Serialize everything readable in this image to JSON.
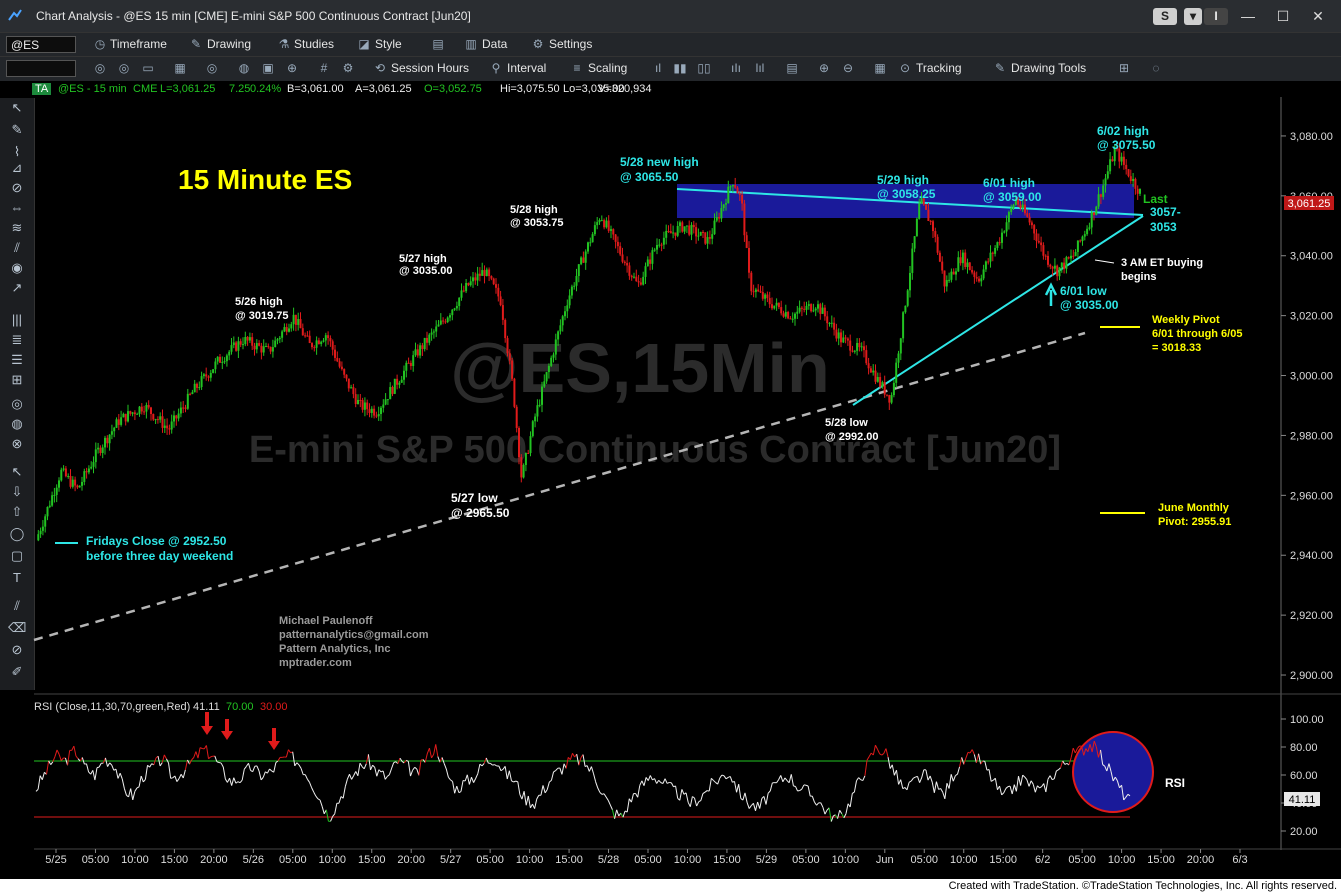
{
  "window": {
    "title": "Chart Analysis - @ES 15 min [CME] E-mini S&P 500 Continuous Contract [Jun20]",
    "badge_s": "S",
    "badge_i": "I",
    "minimize": "—",
    "maximize": "☐",
    "close": "✕"
  },
  "toolbar1": {
    "symbol": "@ES",
    "timeframe": "Timeframe",
    "drawing": "Drawing",
    "studies": "Studies",
    "style": "Style",
    "data": "Data",
    "settings": "Settings"
  },
  "toolbar2": {
    "session_hours": "Session Hours",
    "interval": "Interval",
    "scaling": "Scaling",
    "tracking": "Tracking",
    "drawing_tools": "Drawing Tools"
  },
  "status": {
    "tag": "TA",
    "symbol": "@ES - 15 min",
    "exchange": "CME",
    "last": "L=3,061.25",
    "change": "7.25",
    "change_pct": "0.24%",
    "bid": "B=3,061.00",
    "ask": "A=3,061.25",
    "open": "O=3,052.75",
    "high": "Hi=3,075.50",
    "low": "Lo=3,035.00",
    "volume": "V=320,934"
  },
  "chart_data": {
    "type": "candlestick",
    "title": "15 Minute ES",
    "watermark_symbol": "@ES,15Min",
    "watermark_name": "E-mini S&P 500 Continuous Contract [Jun20]",
    "y_ticks": [
      "3,080.00",
      "3,060.00",
      "3,040.00",
      "3,020.00",
      "3,000.00",
      "2,980.00",
      "2,960.00",
      "2,940.00",
      "2,920.00",
      "2,900.00"
    ],
    "ylim": [
      2895,
      3092
    ],
    "last_price_label": "3,061.25",
    "x_ticks": [
      "5/25",
      "05:00",
      "10:00",
      "15:00",
      "20:00",
      "5/26",
      "05:00",
      "10:00",
      "15:00",
      "20:00",
      "5/27",
      "05:00",
      "10:00",
      "15:00",
      "5/28",
      "05:00",
      "10:00",
      "15:00",
      "5/29",
      "05:00",
      "10:00",
      "Jun",
      "05:00",
      "10:00",
      "15:00",
      "6/2",
      "05:00",
      "10:00",
      "15:00",
      "20:00",
      "6/3"
    ],
    "price_path": [
      [
        0,
        2945
      ],
      [
        0.2,
        2952.5
      ],
      [
        0.6,
        2968
      ],
      [
        1,
        2962
      ],
      [
        1.5,
        2975
      ],
      [
        2,
        2985
      ],
      [
        2.6,
        2990
      ],
      [
        3.2,
        2982
      ],
      [
        3.8,
        2995
      ],
      [
        4.4,
        3005
      ],
      [
        5,
        3012
      ],
      [
        5.6,
        3008
      ],
      [
        6.2,
        3019.75
      ],
      [
        6.6,
        3010
      ],
      [
        7,
        3014
      ],
      [
        7.4,
        3000
      ],
      [
        7.8,
        2990
      ],
      [
        8.2,
        2988
      ],
      [
        8.6,
        2996
      ],
      [
        9.2,
        3008
      ],
      [
        9.8,
        3018
      ],
      [
        10.4,
        3030
      ],
      [
        10.8,
        3035
      ],
      [
        11.2,
        3025
      ],
      [
        11.5,
        2995
      ],
      [
        11.7,
        2965.5
      ],
      [
        12,
        2985
      ],
      [
        12.4,
        3005
      ],
      [
        12.8,
        3025
      ],
      [
        13.2,
        3040
      ],
      [
        13.6,
        3053.75
      ],
      [
        14,
        3043
      ],
      [
        14.5,
        3030
      ],
      [
        15,
        3045
      ],
      [
        15.6,
        3050
      ],
      [
        16.2,
        3045
      ],
      [
        16.8,
        3065.5
      ],
      [
        17,
        3058
      ],
      [
        17.2,
        3030
      ],
      [
        17.6,
        3025
      ],
      [
        18.2,
        3020
      ],
      [
        18.8,
        3024
      ],
      [
        19.4,
        3012
      ],
      [
        19.9,
        3008
      ],
      [
        20.3,
        2998
      ],
      [
        20.6,
        2992
      ],
      [
        20.9,
        3020
      ],
      [
        21.3,
        3058.25
      ],
      [
        21.6,
        3050
      ],
      [
        21.9,
        3030
      ],
      [
        22.3,
        3040
      ],
      [
        22.7,
        3032
      ],
      [
        23.2,
        3045
      ],
      [
        23.6,
        3059
      ],
      [
        24,
        3050
      ],
      [
        24.3,
        3040
      ],
      [
        24.6,
        3035
      ],
      [
        25,
        3040
      ],
      [
        25.4,
        3052
      ],
      [
        25.7,
        3063
      ],
      [
        26,
        3075.5
      ],
      [
        26.3,
        3068
      ],
      [
        26.6,
        3061.25
      ]
    ],
    "rsi": {
      "label": "RSI (Close,11,30,70,green,Red)",
      "value": "41.11",
      "overbought": "70.00",
      "oversold": "30.00",
      "y_ticks": [
        "100.00",
        "80.00",
        "60.00",
        "40.00",
        "20.00"
      ],
      "ylim": [
        10,
        105
      ],
      "series": [
        50,
        62,
        74,
        70,
        78,
        66,
        60,
        72,
        68,
        50,
        45,
        60,
        66,
        72,
        58,
        62,
        70,
        78,
        75,
        64,
        55,
        58,
        66,
        60,
        62,
        70,
        74,
        68,
        58,
        44,
        30,
        42,
        56,
        64,
        70,
        62,
        58,
        70,
        66,
        60,
        74,
        80,
        62,
        50,
        55,
        60,
        70,
        72,
        62,
        56,
        44,
        40,
        50,
        60,
        66,
        72,
        70,
        62,
        48,
        34,
        30,
        44,
        52,
        60,
        56,
        50,
        46,
        40,
        44,
        52,
        58,
        62,
        48,
        40,
        36,
        46,
        55,
        60,
        52,
        48,
        42,
        34,
        28,
        36,
        52,
        66,
        80,
        76,
        60,
        48,
        56,
        60,
        52,
        46,
        62,
        70,
        74,
        68,
        56,
        44,
        50,
        58,
        52,
        48,
        60,
        66,
        74,
        78,
        82,
        74,
        62,
        50,
        41
      ]
    }
  },
  "annotations": {
    "title": "15 Minute ES",
    "fri_close_1": "Fridays Close @ 2952.50",
    "fri_close_2": "before three day weekend",
    "h526_1": "5/26 high",
    "h526_2": "@ 3019.75",
    "h527_1": "5/27 high",
    "h527_2": "@ 3035.00",
    "h528_1": "5/28 high",
    "h528_2": "@ 3053.75",
    "nh528_1": "5/28 new high",
    "nh528_2": "@ 3065.50",
    "l527_1": "5/27 low",
    "l527_2": "@ 2965.50",
    "h529_1": "5/29 high",
    "h529_2": "@ 3058.25",
    "h601_1": "6/01 high",
    "h601_2": "@ 3059.00",
    "h602_1": "6/02 high",
    "h602_2": "@ 3075.50",
    "last_1": "Last",
    "last_2": "3057-",
    "last_3": "3053",
    "buying_1": "3 AM ET buying",
    "buying_2": "begins",
    "l601_1": "6/01 low",
    "l601_2": "@ 3035.00",
    "l528_1": "5/28 low",
    "l528_2": "@ 2992.00",
    "weekly_1": "Weekly Pivot",
    "weekly_2": "6/01 through 6/05",
    "weekly_3": "= 3018.33",
    "monthly_1": "June Monthly",
    "monthly_2": "Pivot: 2955.91",
    "author_1": "Michael Paulenoff",
    "author_2": "patternanalytics@gmail.com",
    "author_3": "Pattern Analytics, Inc",
    "author_4": "mptrader.com",
    "rsi_tag": "RSI"
  },
  "colors": {
    "up": "#22c322",
    "down": "#e01b1b",
    "accent": "#2ee6e6",
    "highlight": "#ffff00",
    "zone": "#1a1a9a"
  },
  "footer": {
    "credit": "Created with TradeStation. ©TradeStation Technologies, Inc. All rights reserved."
  }
}
